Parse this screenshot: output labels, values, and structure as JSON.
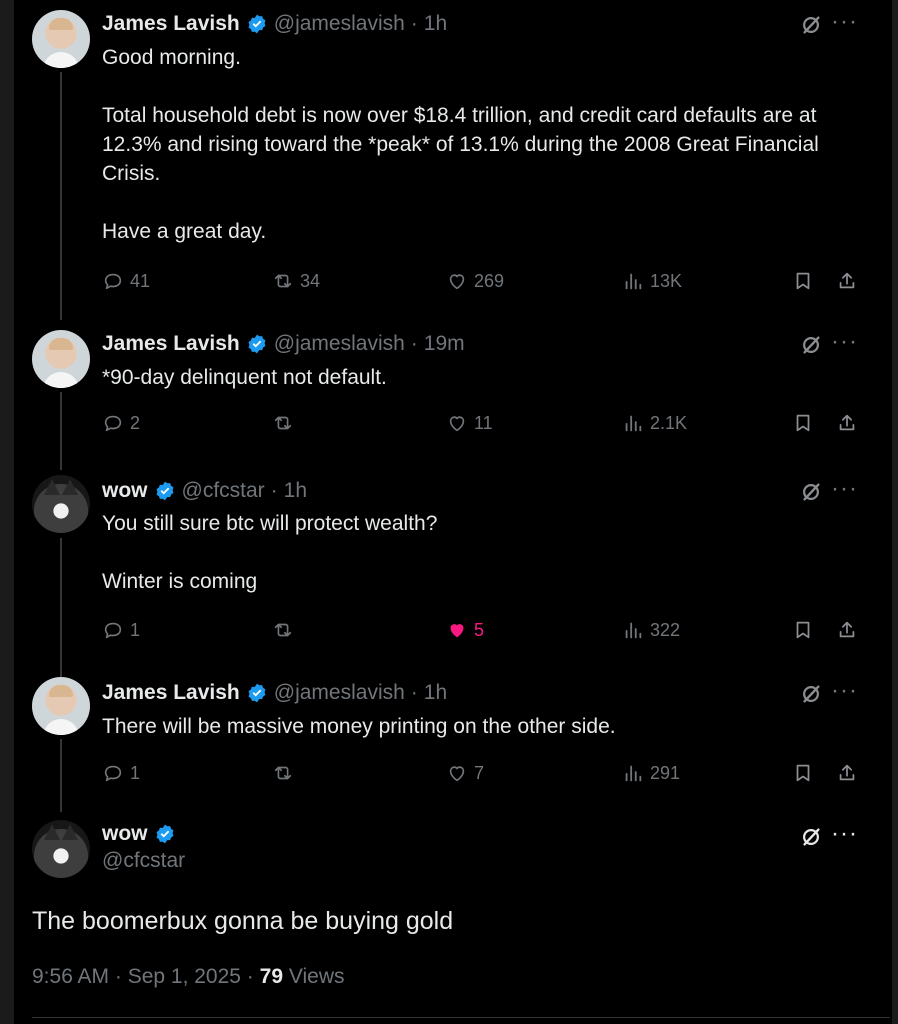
{
  "colors": {
    "background": "#000000",
    "text": "#e7e9ea",
    "muted": "#71767b",
    "verified": "#1d9bf0",
    "like_active": "#f91880"
  },
  "tweets": [
    {
      "name": "James Lavish",
      "handle": "@jameslavish",
      "sep": "·",
      "time": "1h",
      "text": "Good morning.\n\nTotal household debt is now over $18.4 trillion, and credit card defaults are at 12.3% and rising toward the *peak* of 13.1% during the 2008 Great Financial Crisis.\n\nHave a great day.",
      "replies": "41",
      "reposts": "34",
      "likes": "269",
      "views": "13K"
    },
    {
      "name": "James Lavish",
      "handle": "@jameslavish",
      "sep": "·",
      "time": "19m",
      "text": "*90-day delinquent not default.",
      "replies": "2",
      "reposts": "",
      "likes": "11",
      "views": "2.1K"
    },
    {
      "name": "wow",
      "handle": "@cfcstar",
      "sep": "·",
      "time": "1h",
      "text": "You still sure btc will protect wealth?\n\nWinter is coming",
      "replies": "1",
      "reposts": "",
      "likes": "5",
      "views": "322",
      "liked": true
    },
    {
      "name": "James Lavish",
      "handle": "@jameslavish",
      "sep": "·",
      "time": "1h",
      "text": "There will be massive money printing on the other side.",
      "replies": "1",
      "reposts": "",
      "likes": "7",
      "views": "291"
    }
  ],
  "main": {
    "name": "wow",
    "handle": "@cfcstar",
    "text": "The boomerbux gonna be buying gold",
    "time": "9:56 AM · Sep 1, 2025 ·",
    "views_count": "79",
    "views_label": "Views"
  },
  "icons": {
    "more": "···"
  }
}
